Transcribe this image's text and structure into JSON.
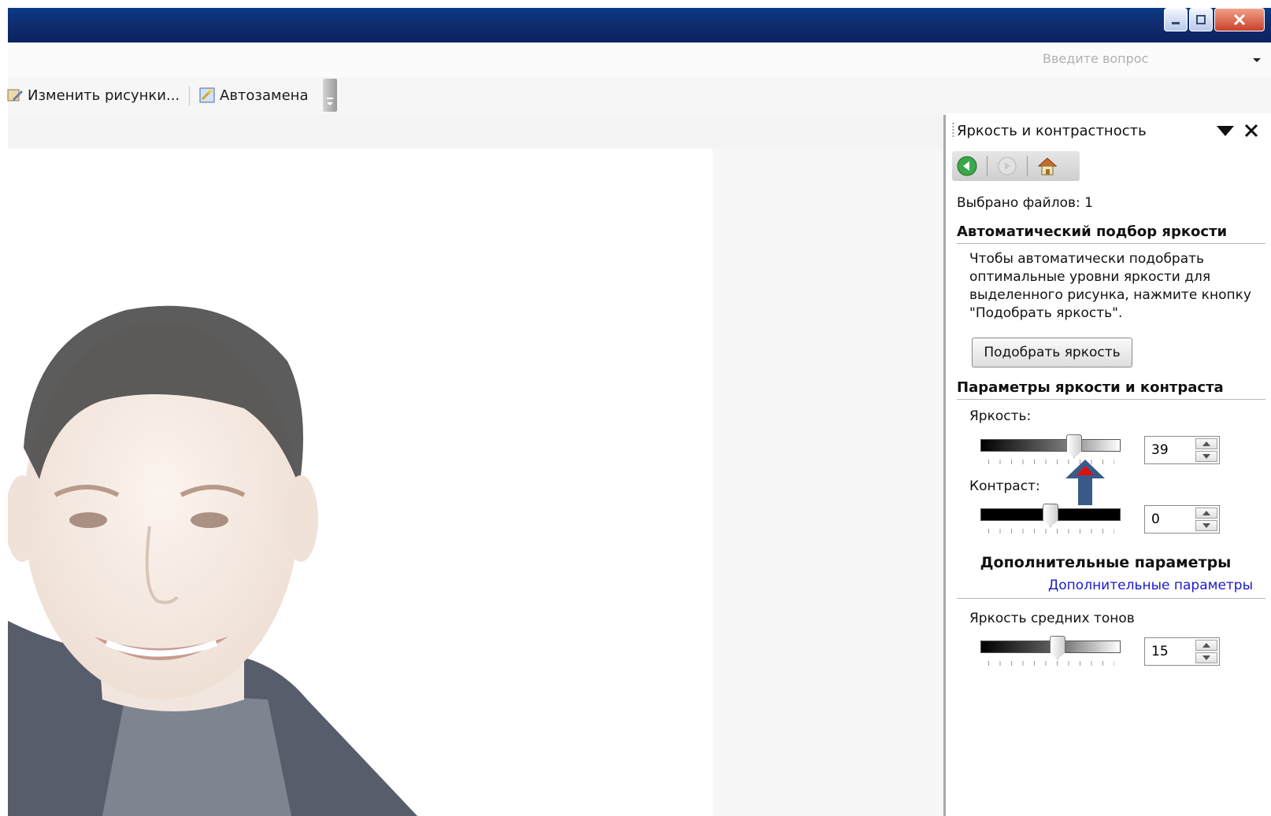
{
  "window": {
    "question_placeholder": "Введите вопрос"
  },
  "toolbar": {
    "edit_pictures_label": "Изменить рисунки...",
    "autocorrect_label": "Автозамена"
  },
  "task_pane": {
    "title": "Яркость и контрастность",
    "selected_files": "Выбрано файлов: 1",
    "auto_section_title": "Автоматический подбор яркости",
    "auto_description_lines": [
      "Чтобы автоматически подобрать",
      "оптимальные уровни яркости для",
      "выделенного рисунка, нажмите кнопку",
      "\"Подобрать яркость\"."
    ],
    "auto_button_label": "Подобрать яркость",
    "params_section_title": "Параметры яркости и контраста",
    "brightness_label": "Яркость:",
    "brightness_value": "39",
    "brightness_level": 0.67,
    "contrast_label": "Контраст:",
    "contrast_value": "0",
    "contrast_level": 0.5,
    "advanced_heading": "Дополнительные параметры",
    "advanced_link": "Дополнительные параметры",
    "midtone_label": "Яркость средних тонов",
    "midtone_value": "15",
    "midtone_level": 0.55
  },
  "colors": {
    "titlebar": "#0f2b6b",
    "link": "#1a1acc",
    "pointer_arrow": "#3a5a8a",
    "pointer_tip": "#e01010"
  }
}
